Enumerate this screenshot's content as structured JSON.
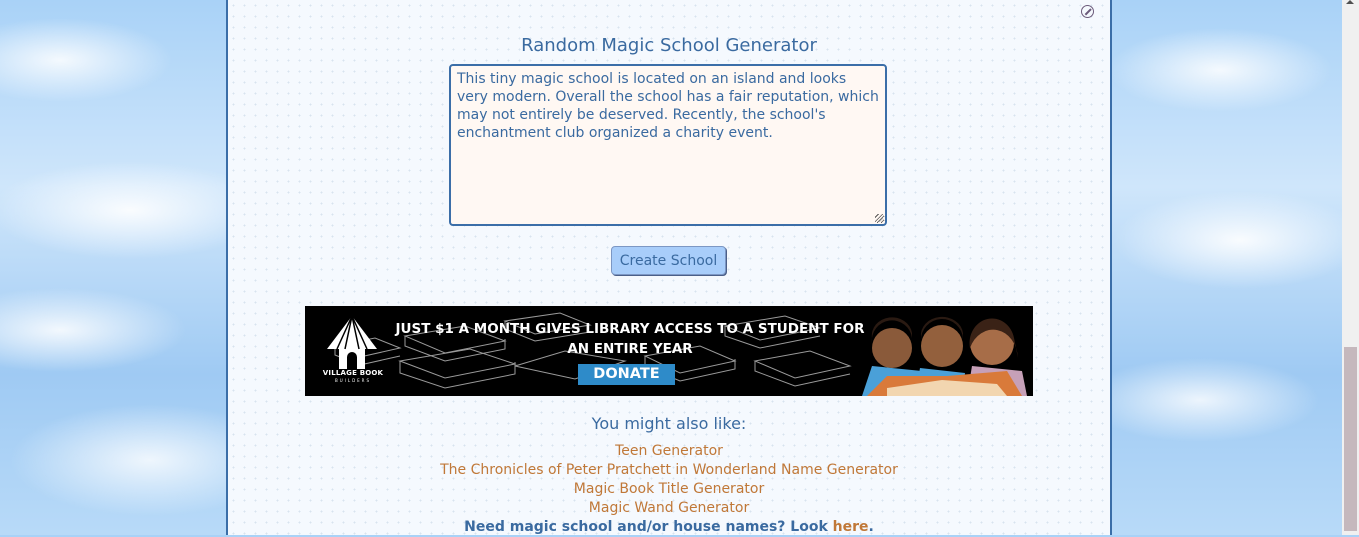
{
  "page": {
    "title": "Random Magic School Generator",
    "output_text": "This tiny magic school is located on an island and looks very modern.  Overall the school has a fair reputation, which may not entirely be deserved.  Recently, the school's enchantment club organized a charity event.",
    "create_button_label": "Create School",
    "close_icon": "block-circle-icon"
  },
  "ad": {
    "logo_text": "VILLAGE BOOK",
    "logo_subtext": "BUILDERS",
    "headline_line1": "JUST $1 A MONTH GIVES LIBRARY ACCESS TO A STUDENT FOR",
    "headline_line2": "AN ENTIRE YEAR",
    "donate_label": "DONATE",
    "colors": {
      "background": "#000000",
      "donate": "#2e8bc9"
    }
  },
  "related": {
    "heading": "You might also like:",
    "links": [
      "Teen Generator",
      "The Chronicles of Peter Pratchett in Wonderland Name Generator",
      "Magic Book Title Generator",
      "Magic Wand Generator"
    ],
    "footer_prefix": "Need magic school and/or house names? Look ",
    "footer_link": "here",
    "footer_suffix": "."
  },
  "colors": {
    "text_blue": "#3a6aa0",
    "link_orange": "#c07838",
    "button_blue": "#a8cdfa",
    "border_blue": "#3b6ea8",
    "textarea_bg": "#fff8f3"
  }
}
